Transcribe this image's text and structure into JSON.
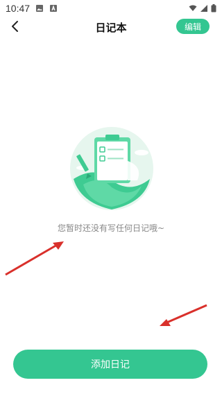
{
  "status_bar": {
    "time": "10:47",
    "left_icons": [
      "image-icon",
      "font-icon"
    ],
    "right_icons": [
      "wifi-icon",
      "signal-icon",
      "battery-icon"
    ]
  },
  "header": {
    "back_icon": "chevron-left-icon",
    "title": "日记本",
    "edit_label": "编辑"
  },
  "empty_state": {
    "illustration_icon": "clipboard-empty-icon",
    "message": "您暂时还没有写任何日记哦~"
  },
  "annotations": {
    "arrow_color": "#d9302b"
  },
  "footer": {
    "add_label": "添加日记"
  },
  "colors": {
    "accent": "#34c691",
    "illustration_bg": "#e6f6ee"
  }
}
